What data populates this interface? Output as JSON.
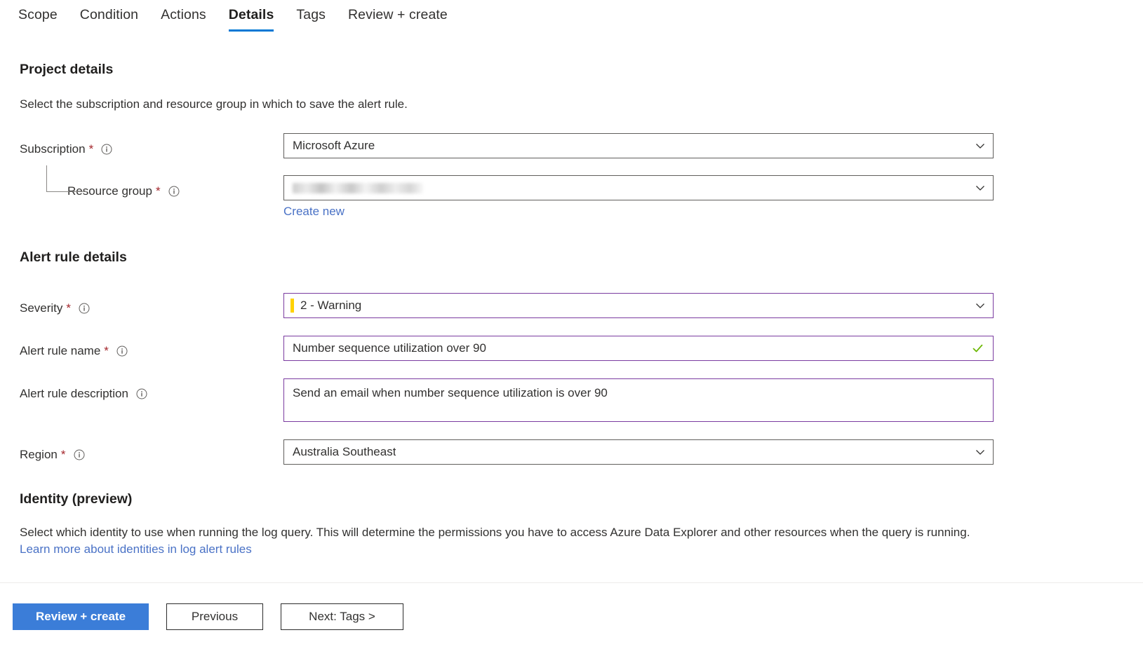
{
  "tabs": [
    {
      "label": "Scope",
      "active": false
    },
    {
      "label": "Condition",
      "active": false
    },
    {
      "label": "Actions",
      "active": false
    },
    {
      "label": "Details",
      "active": true
    },
    {
      "label": "Tags",
      "active": false
    },
    {
      "label": "Review + create",
      "active": false
    }
  ],
  "project_details": {
    "heading": "Project details",
    "description": "Select the subscription and resource group in which to save the alert rule.",
    "subscription": {
      "label": "Subscription",
      "required": "*",
      "value": "Microsoft Azure",
      "icon": "info-icon",
      "chevron": "chevron-down-icon"
    },
    "resource_group": {
      "label": "Resource group",
      "required": "*",
      "value": "",
      "redacted": true,
      "icon": "info-icon",
      "chevron": "chevron-down-icon",
      "create_new_label": "Create new"
    }
  },
  "alert_rule_details": {
    "heading": "Alert rule details",
    "severity": {
      "label": "Severity",
      "required": "*",
      "value": "2 - Warning",
      "severity_color": "#ffd200",
      "icon": "info-icon",
      "chevron": "chevron-down-icon"
    },
    "alert_rule_name": {
      "label": "Alert rule name",
      "required": "*",
      "value": "Number sequence utilization over 90",
      "placeholder": "",
      "valid": true,
      "valid_icon": "checkmark-icon",
      "valid_color": "#6bb700",
      "icon": "info-icon"
    },
    "alert_rule_description": {
      "label": "Alert rule description",
      "value": "Send an email when number sequence utilization is over 90",
      "placeholder": "",
      "icon": "info-icon"
    },
    "region": {
      "label": "Region",
      "required": "*",
      "value": "Australia Southeast",
      "icon": "info-icon",
      "chevron": "chevron-down-icon"
    }
  },
  "identity": {
    "heading": "Identity (preview)",
    "description_part1": "Select which identity to use when running the log query. This will determine the permissions you have to access Azure Data Explorer and other resources when the query is running.",
    "link_label": "Learn more about identities in log alert rules"
  },
  "footer": {
    "review_create_label": "Review + create",
    "previous_label": "Previous",
    "next_label": "Next: Tags >"
  },
  "colors": {
    "accent": "#0078d4",
    "primary_button": "#3b7dd8",
    "link": "#4a72c6",
    "required": "#a4262c",
    "focus_border": "#7a3ba0",
    "severity_warning": "#ffd200",
    "valid_check": "#6bb700"
  }
}
